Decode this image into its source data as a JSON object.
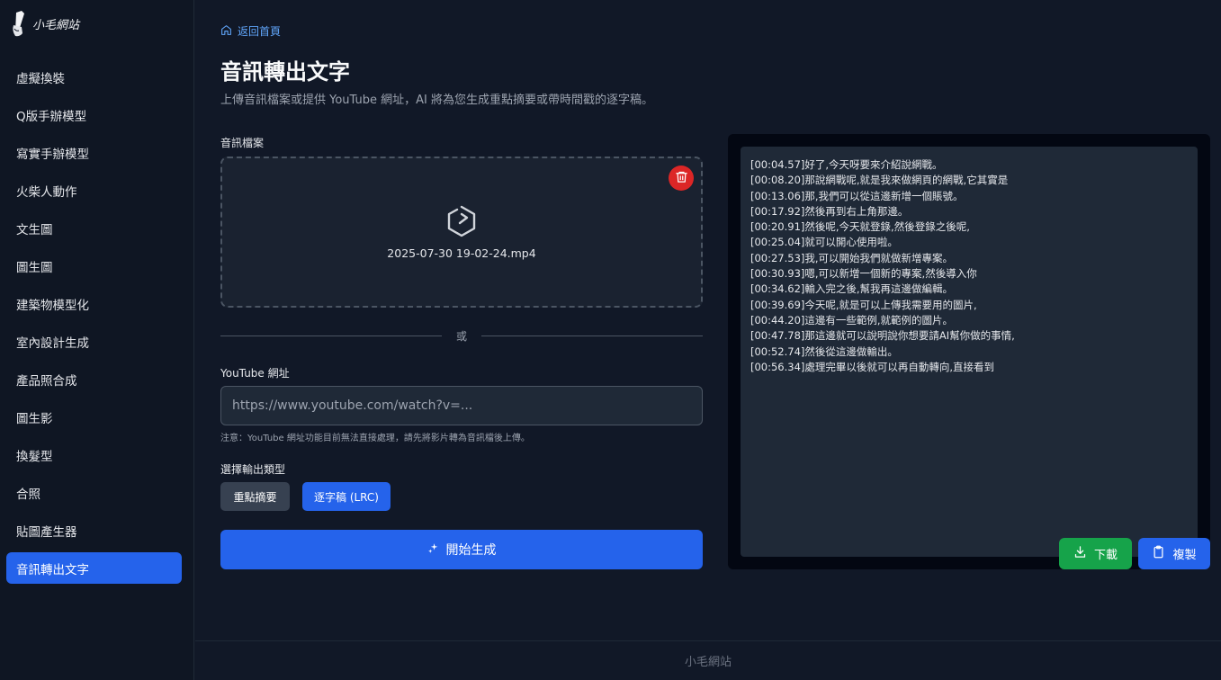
{
  "brand": {
    "logo_text": "小毛網站"
  },
  "sidebar": {
    "items": [
      {
        "label": "虛擬換裝"
      },
      {
        "label": "Q版手辦模型"
      },
      {
        "label": "寫實手辦模型"
      },
      {
        "label": "火柴人動作"
      },
      {
        "label": "文生圖"
      },
      {
        "label": "圖生圖"
      },
      {
        "label": "建築物模型化"
      },
      {
        "label": "室內設計生成"
      },
      {
        "label": "產品照合成"
      },
      {
        "label": "圖生影"
      },
      {
        "label": "換髮型"
      },
      {
        "label": "合照"
      },
      {
        "label": "貼圖產生器"
      },
      {
        "label": "音訊轉出文字",
        "active": true
      }
    ]
  },
  "header": {
    "back_link": "返回首頁",
    "title": "音訊轉出文字",
    "subtitle": "上傳音訊檔案或提供 YouTube 網址，AI 將為您生成重點摘要或帶時間戳的逐字稿。"
  },
  "upload": {
    "label": "音訊檔案",
    "file_name": "2025-07-30 19-02-24.mp4"
  },
  "divider": {
    "text": "或"
  },
  "youtube": {
    "label": "YouTube 網址",
    "placeholder": "https://www.youtube.com/watch?v=...",
    "value": "",
    "note": "注意：YouTube 網址功能目前無法直接處理，請先將影片轉為音訊檔後上傳。"
  },
  "output_type": {
    "label": "選擇輸出類型",
    "options": [
      "重點摘要",
      "逐字稿 (LRC)"
    ],
    "selected": "逐字稿 (LRC)"
  },
  "generate": {
    "label": "開始生成"
  },
  "output": {
    "lines": [
      "[00:04.57]好了,今天呀要來介紹說網戰。",
      "[00:08.20]那說網戰呢,就是我來做網頁的網戰,它其實是",
      "[00:13.06]那,我們可以從這邊新增一個賬號。",
      "[00:17.92]然後再到右上角那邊。",
      "[00:20.91]然後呢,今天就登錄,然後登錄之後呢,",
      "[00:25.04]就可以開心使用啦。",
      "[00:27.53]我,可以開始我們就做新增專案。",
      "[00:30.93]嗯,可以新增一個新的專案,然後導入你",
      "[00:34.62]輸入完之後,幫我再這邊做編輯。",
      "[00:39.69]今天呢,就是可以上傳我需要用的圖片,",
      "[00:44.20]這邊有一些範例,就範例的圖片。",
      "[00:47.78]那這邊就可以說明說你想要請AI幫你做的事情,",
      "[00:52.74]然後從這邊做輸出。",
      "[00:56.34]處理完畢以後就可以再自動轉向,直接看到"
    ],
    "download_label": "下載",
    "copy_label": "複製"
  },
  "footer": {
    "text": "小毛網站"
  },
  "colors": {
    "accent": "#2563eb",
    "success": "#16a34a",
    "danger": "#dc2626",
    "background": "#111827"
  }
}
